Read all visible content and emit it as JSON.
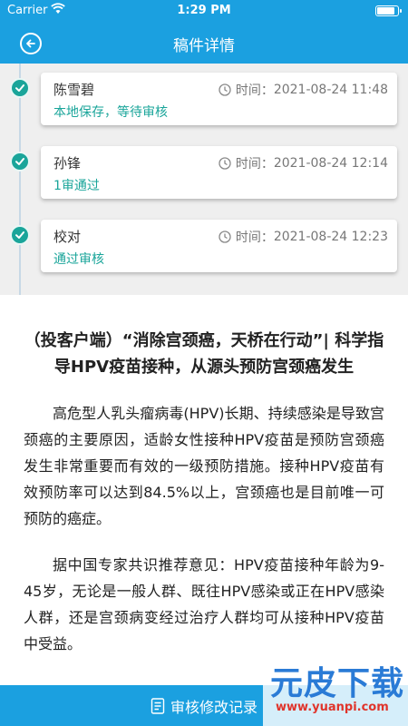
{
  "status_bar": {
    "carrier": "Carrier",
    "time": "1:29 PM"
  },
  "header": {
    "title": "稿件详情"
  },
  "timeline": [
    {
      "name": "陈雪碧",
      "time_label": "时间：",
      "time": "2021-08-24 11:48",
      "status": "本地保存，等待审核"
    },
    {
      "name": "孙锋",
      "time_label": "时间：",
      "time": "2021-08-24 12:14",
      "status": "1审通过"
    },
    {
      "name": "校对",
      "time_label": "时间：",
      "time": "2021-08-24 12:23",
      "status": "通过审核"
    }
  ],
  "article": {
    "title": "（投客户端）“消除宫颈癌，天桥在行动”| 科学指导HPV疫苗接种，从源头预防宫颈癌发生",
    "paragraphs": [
      "高危型人乳头瘤病毒(HPV)长期、持续感染是导致宫颈癌的主要原因，适龄女性接种HPV疫苗是预防宫颈癌发生非常重要而有效的一级预防措施。接种HPV疫苗有效预防率可以达到84.5%以上，宫颈癌也是目前唯一可预防的癌症。",
      "据中国专家共识推荐意见：HPV疫苗接种年龄为9-45岁，无论是一般人群、既往HPV感染或正在HPV感染人群，还是宫颈病变经过治疗人群均可从接种HPV疫苗中受益。"
    ]
  },
  "bottom_bar": {
    "label": "审核修改记录"
  },
  "watermark": {
    "text": "元皮下载",
    "url": "www.yuanpi.com"
  },
  "colors": {
    "primary": "#1ba0e0",
    "success": "#1aa59a"
  }
}
